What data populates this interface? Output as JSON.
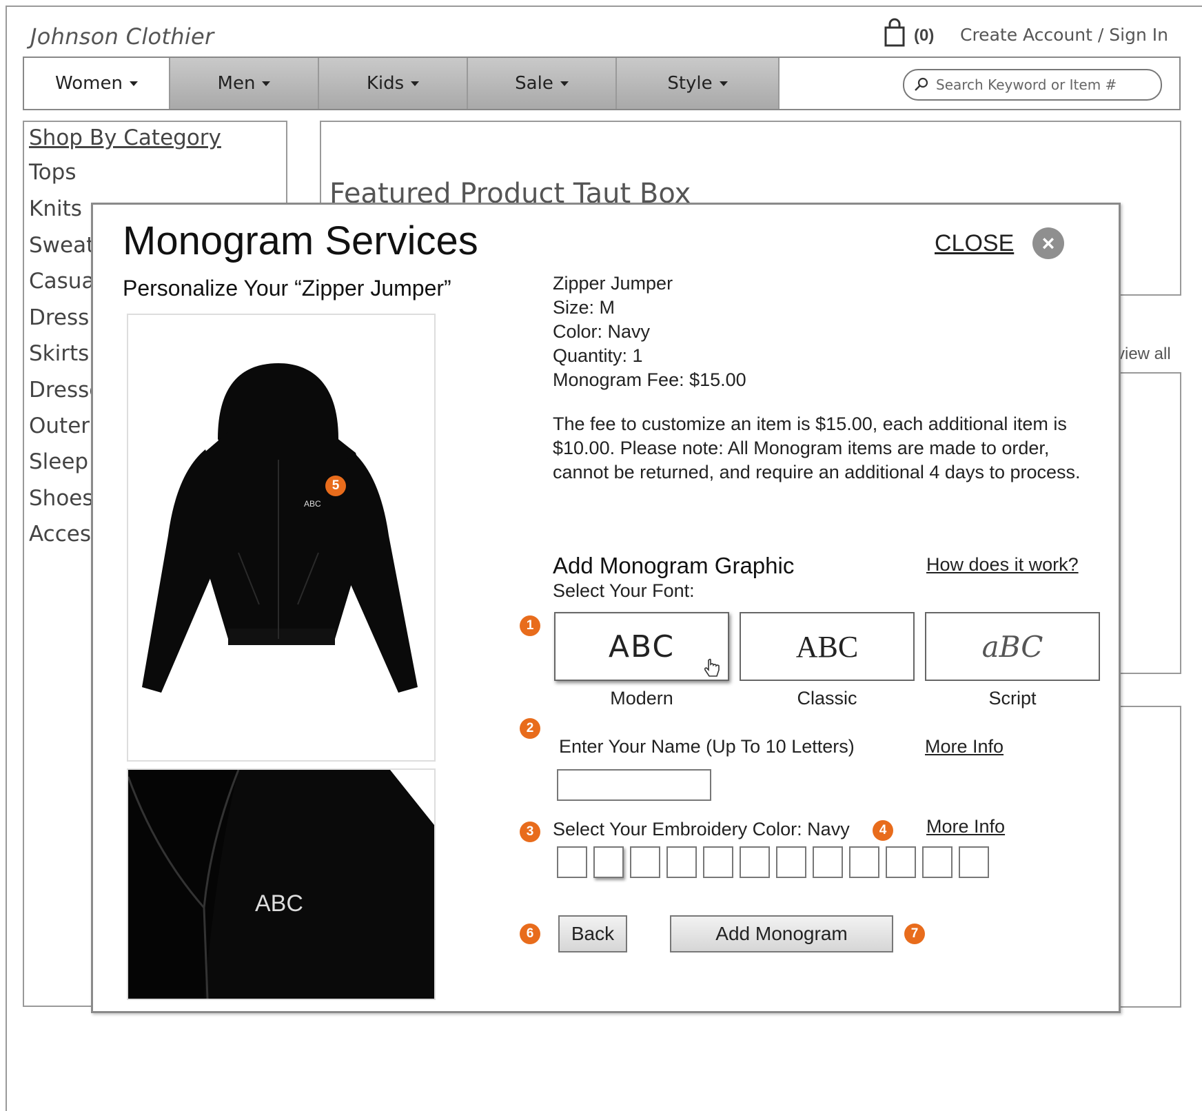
{
  "header": {
    "brand": "Johnson Clothier",
    "cart_count": "(0)",
    "account_link": "Create Account / Sign In"
  },
  "nav": {
    "items": [
      {
        "label": "Women"
      },
      {
        "label": "Men"
      },
      {
        "label": "Kids"
      },
      {
        "label": "Sale"
      },
      {
        "label": "Style"
      }
    ],
    "search_placeholder": "Search Keyword or Item #"
  },
  "sidebar": {
    "title": "Shop By Category",
    "items": [
      "Tops",
      "Knits",
      "Sweat",
      "Casua",
      "Dress",
      "Skirts",
      "Dresse",
      "Outer",
      "Sleep",
      "Shoes",
      "Acces"
    ]
  },
  "featured": {
    "title": "Featured Product Taut Box",
    "view_all": "view all"
  },
  "modal": {
    "title": "Monogram Services",
    "close_label": "CLOSE",
    "personalize": "Personalize Your “Zipper Jumper”",
    "image_monogram_text": "ABC",
    "detail_monogram_text": "ABC",
    "product": {
      "name": "Zipper Jumper",
      "size": "Size: M",
      "color": "Color: Navy",
      "quantity": "Quantity: 1",
      "fee": "Monogram Fee: $15.00"
    },
    "description": "The fee to customize an item is $15.00, each additional item is $10.00. Please note: All Monogram items are made to order, cannot be returned, and require an additional 4 days to process.",
    "graphic_heading": "Add Monogram Graphic",
    "how_link": "How does it work?",
    "select_font": "Select Your Font:",
    "fonts": [
      {
        "sample": "ABC",
        "label": "Modern"
      },
      {
        "sample": "ABC",
        "label": "Classic"
      },
      {
        "sample": "aBC",
        "label": "Script"
      }
    ],
    "enter_name_label": "Enter Your Name (Up To 10 Letters)",
    "name_value": "",
    "more_info_1": "More Info",
    "embroidery_label": "Select Your Embroidery Color: Navy",
    "more_info_2": "More Info",
    "swatch_count": 12,
    "back_button": "Back",
    "add_button": "Add Monogram",
    "badges": [
      "1",
      "2",
      "3",
      "4",
      "5",
      "6",
      "7"
    ],
    "badge_color": "#e86c1c"
  }
}
